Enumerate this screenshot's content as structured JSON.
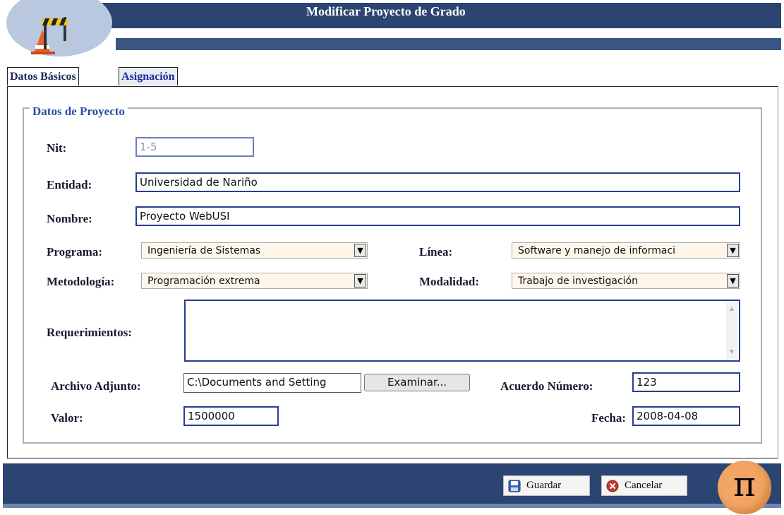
{
  "header": {
    "title": "Modificar Proyecto de Grado"
  },
  "tabs": [
    {
      "label": "Datos Básicos"
    },
    {
      "label": "Asignación"
    }
  ],
  "group": {
    "legend": "Datos de Proyecto"
  },
  "fields": {
    "nit": {
      "label": "Nit:",
      "value": "1-5"
    },
    "entidad": {
      "label": "Entidad:",
      "value": "Universidad de Nariño"
    },
    "nombre": {
      "label": "Nombre:",
      "value": "Proyecto WebUSI"
    },
    "programa": {
      "label": "Programa:",
      "value": "Ingeniería de Sistemas"
    },
    "linea": {
      "label": "Línea:",
      "value": "Software y manejo de informaci"
    },
    "metodologia": {
      "label": "Metodología:",
      "value": "Programación extrema"
    },
    "modalidad": {
      "label": "Modalidad:",
      "value": "Trabajo de investigación"
    },
    "requerimientos": {
      "label": "Requerimientos:",
      "value": ""
    },
    "archivo": {
      "label": "Archivo Adjunto:",
      "value": "C:\\Documents and Setting",
      "button": "Examinar..."
    },
    "acuerdo": {
      "label": "Acuerdo Número:",
      "value": "123"
    },
    "valor": {
      "label": "Valor:",
      "value": "1500000"
    },
    "fecha": {
      "label": "Fecha:",
      "value": "2008-04-08"
    }
  },
  "footer": {
    "save_label": "Guardar",
    "cancel_label": "Cancelar",
    "logo_symbol": "π"
  },
  "colors": {
    "header": "#2c4471",
    "accent": "#2a3d8f",
    "legend": "#2b4aa6",
    "logo": "#f2a564"
  }
}
